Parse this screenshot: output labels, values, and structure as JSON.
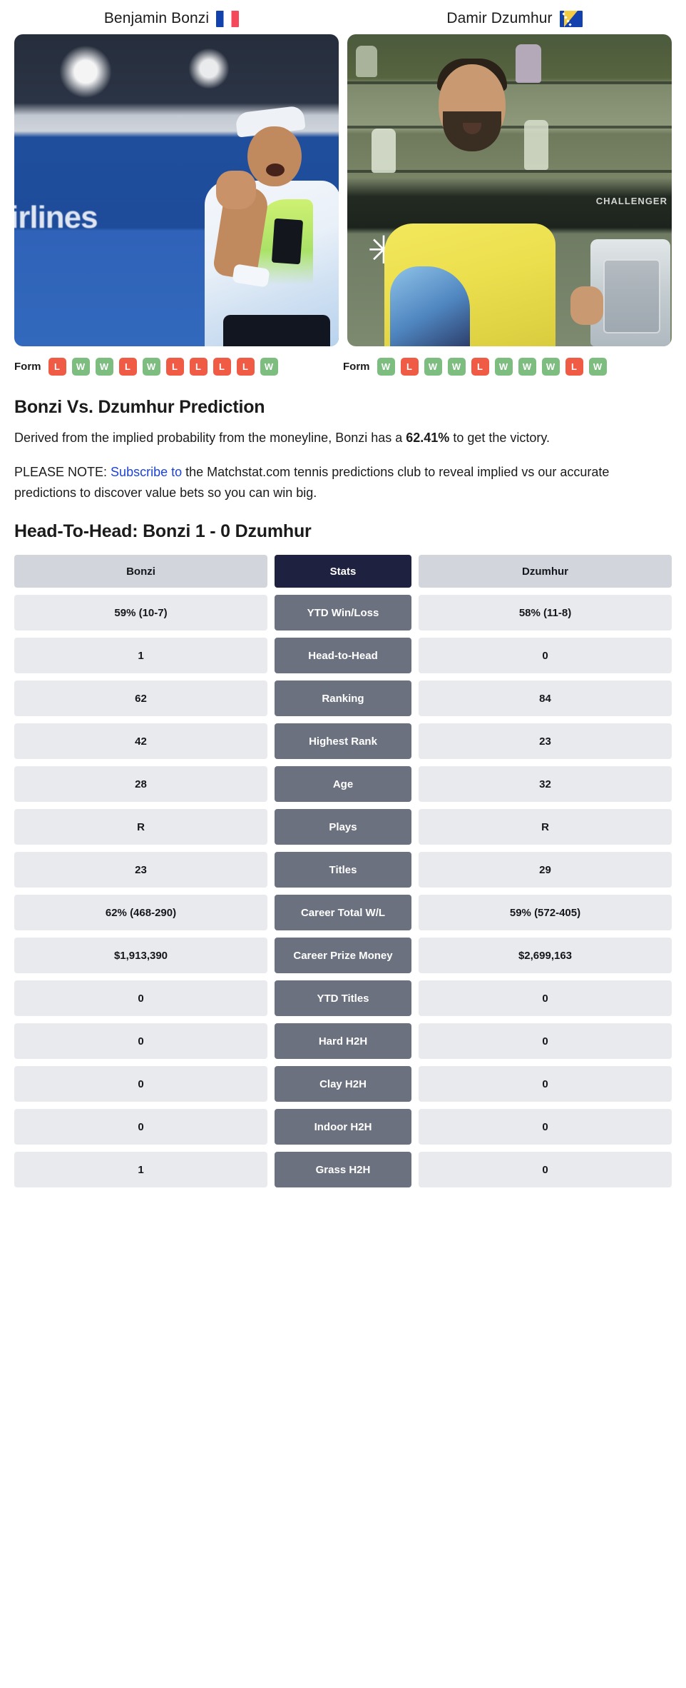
{
  "players": [
    {
      "name": "Benjamin Bonzi",
      "flag": "fr-flag-icon",
      "short": "Bonzi"
    },
    {
      "name": "Damir Dzumhur",
      "flag": "ba-flag-icon",
      "short": "Dzumhur"
    }
  ],
  "form": {
    "label": "Form",
    "bonzi": [
      "L",
      "W",
      "W",
      "L",
      "W",
      "L",
      "L",
      "L",
      "L",
      "W"
    ],
    "dzumhur": [
      "W",
      "L",
      "W",
      "W",
      "L",
      "W",
      "W",
      "W",
      "L",
      "W"
    ]
  },
  "photos": {
    "bonzi_signage": "irlines",
    "dzumhur_banner": "CHALLENGER",
    "dzumhur_logo_glyph": "✳"
  },
  "prediction": {
    "title": "Bonzi Vs. Dzumhur Prediction",
    "line1_prefix": "Derived from the implied probability from the moneyline, Bonzi has a ",
    "probability": "62.41%",
    "line1_suffix": " to get the victory.",
    "note_prefix": "PLEASE NOTE: ",
    "note_link": "Subscribe to",
    "note_suffix": " the Matchstat.com tennis predictions club to reveal implied vs our accurate predictions to discover value bets so you can win big."
  },
  "h2h": {
    "title": "Head-To-Head: Bonzi 1 - 0 Dzumhur",
    "header": {
      "left": "Bonzi",
      "middle": "Stats",
      "right": "Dzumhur"
    },
    "rows": [
      {
        "left": "59% (10-7)",
        "stat": "YTD Win/Loss",
        "right": "58% (11-8)"
      },
      {
        "left": "1",
        "stat": "Head-to-Head",
        "right": "0"
      },
      {
        "left": "62",
        "stat": "Ranking",
        "right": "84"
      },
      {
        "left": "42",
        "stat": "Highest Rank",
        "right": "23"
      },
      {
        "left": "28",
        "stat": "Age",
        "right": "32"
      },
      {
        "left": "R",
        "stat": "Plays",
        "right": "R"
      },
      {
        "left": "23",
        "stat": "Titles",
        "right": "29"
      },
      {
        "left": "62% (468-290)",
        "stat": "Career Total W/L",
        "right": "59% (572-405)"
      },
      {
        "left": "$1,913,390",
        "stat": "Career Prize Money",
        "right": "$2,699,163"
      },
      {
        "left": "0",
        "stat": "YTD Titles",
        "right": "0"
      },
      {
        "left": "0",
        "stat": "Hard H2H",
        "right": "0"
      },
      {
        "left": "0",
        "stat": "Clay H2H",
        "right": "0"
      },
      {
        "left": "0",
        "stat": "Indoor H2H",
        "right": "0"
      },
      {
        "left": "1",
        "stat": "Grass H2H",
        "right": "0"
      }
    ]
  },
  "colors": {
    "win": "#7dbd80",
    "loss": "#f05b45",
    "stat_mid": "#6b717f",
    "header_mid": "#1e2140",
    "cell_side": "#e8eaee",
    "header_side": "#d2d6dc",
    "link": "#1c42d6"
  }
}
